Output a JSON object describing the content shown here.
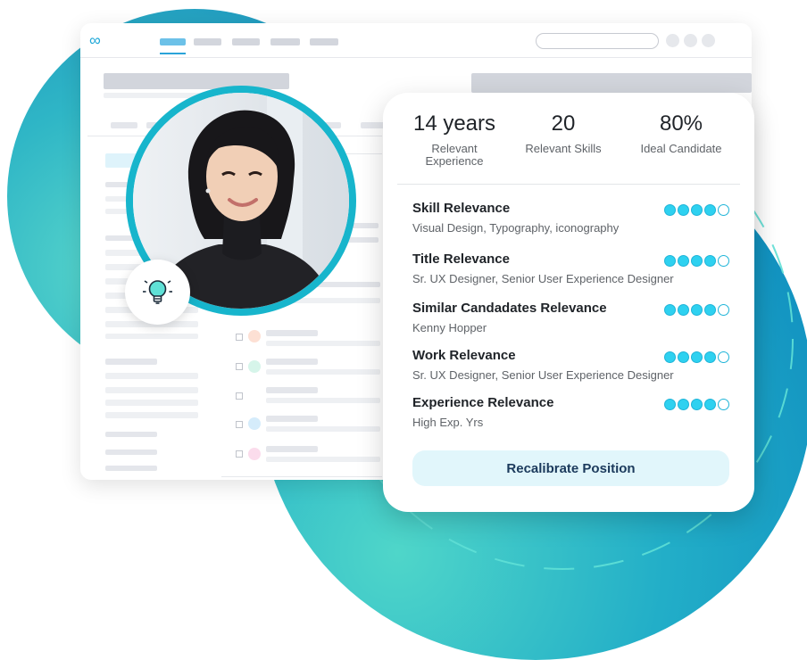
{
  "stats": [
    {
      "value": "14 years",
      "label": "Relevant Experience"
    },
    {
      "value": "20",
      "label": "Relevant Skills"
    },
    {
      "value": "80%",
      "label": "Ideal Candidate"
    }
  ],
  "relevance": [
    {
      "title": "Skill Relevance",
      "detail": "Visual Design, Typography, iconography",
      "rating": 4,
      "max": 5
    },
    {
      "title": "Title Relevance",
      "detail": "Sr. UX Designer, Senior User Experience Designer",
      "rating": 4,
      "max": 5
    },
    {
      "title": "Similar Candadates Relevance",
      "detail": "Kenny Hopper",
      "rating": 4,
      "max": 5
    },
    {
      "title": "Work Relevance",
      "detail": "Sr. UX Designer, Senior User Experience Designer",
      "rating": 4,
      "max": 5
    },
    {
      "title": "Experience Relevance",
      "detail": "High Exp. Yrs",
      "rating": 4,
      "max": 5
    }
  ],
  "button": {
    "label": "Recalibrate Position"
  },
  "icons": {
    "logo": "link-logo-icon",
    "bulb": "lightbulb-icon"
  },
  "colors": {
    "accent": "#17b5cc",
    "rating_fill": "#2ed1f0",
    "button_bg": "#e1f6fb",
    "button_text": "#1b3a5c"
  }
}
